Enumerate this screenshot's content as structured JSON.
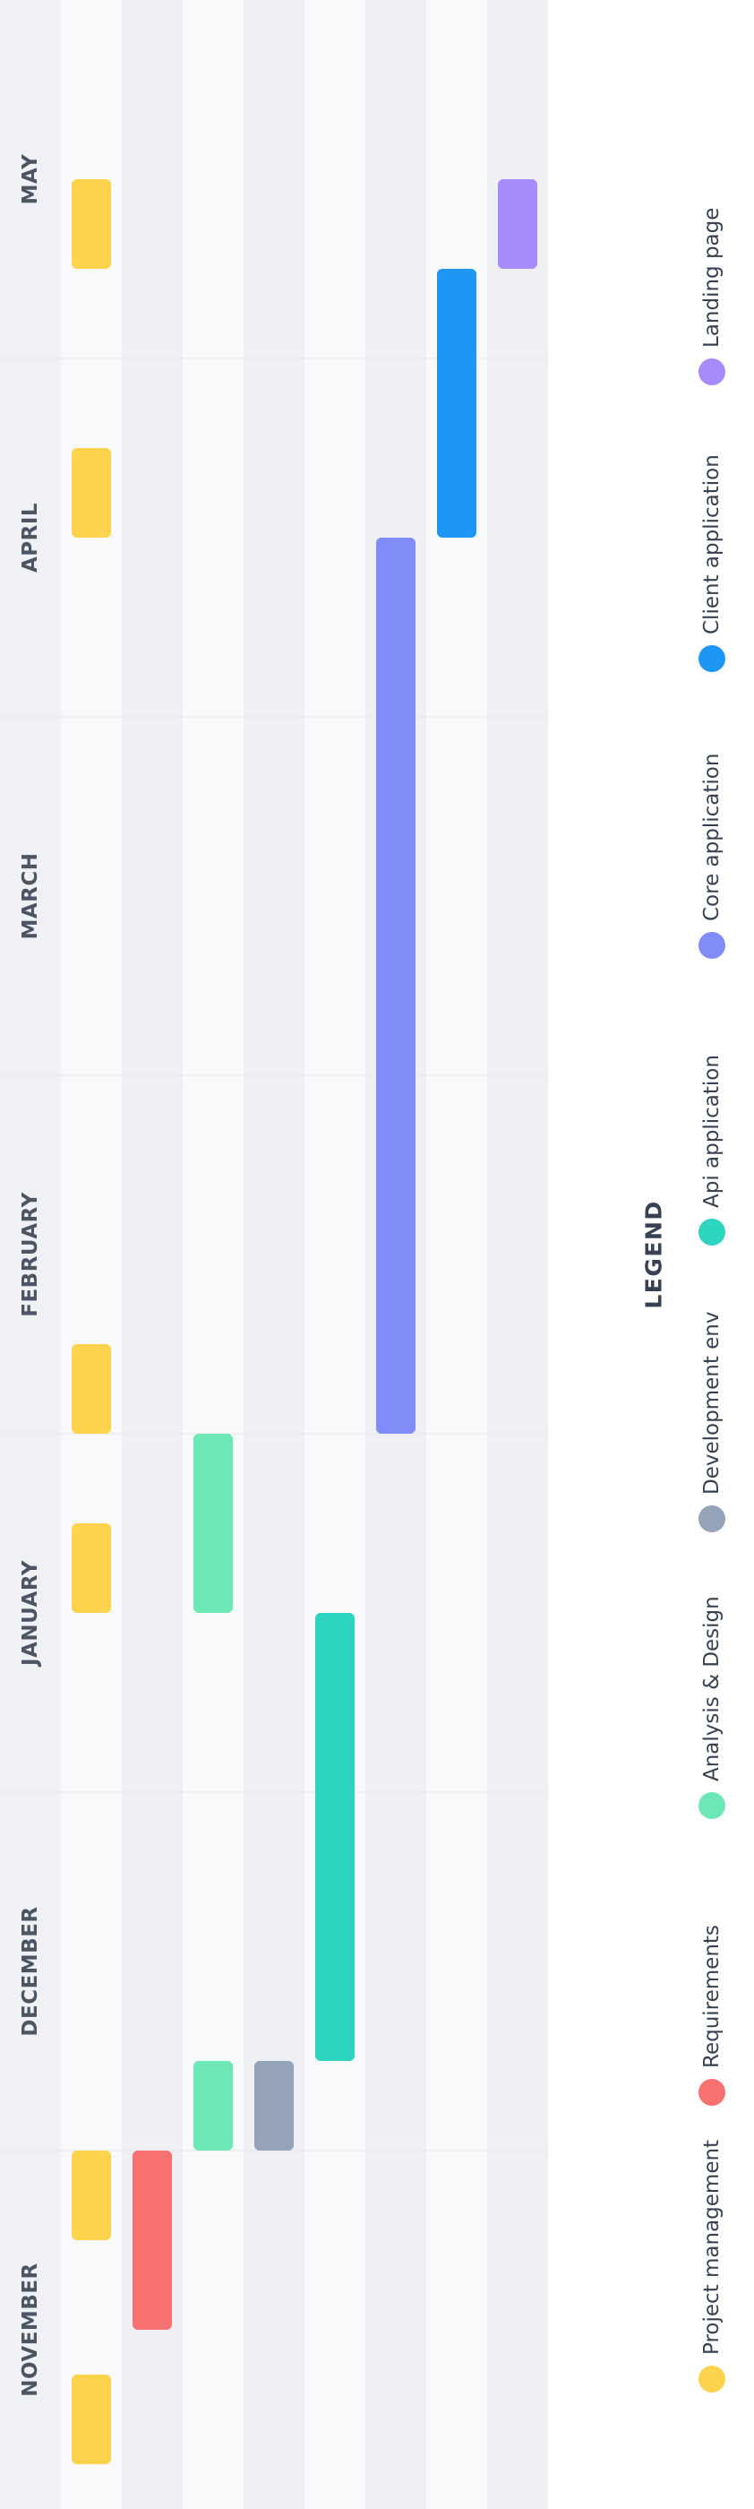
{
  "chart_data": {
    "type": "gantt",
    "title": "",
    "months": [
      "NOVEMBER",
      "DECEMBER",
      "JANUARY",
      "FEBRUARY",
      "MARCH",
      "APRIL",
      "MAY"
    ],
    "time_unit": "weeks",
    "weeks_per_month": 4,
    "legend_title": "LEGEND",
    "categories": [
      {
        "name": "Project management",
        "color": "#fcd34d"
      },
      {
        "name": "Requirements",
        "color": "#f87171"
      },
      {
        "name": "Analysis & Design",
        "color": "#6ee7b7"
      },
      {
        "name": "Development env",
        "color": "#94a3b8"
      },
      {
        "name": "Api application",
        "color": "#2dd4bf"
      },
      {
        "name": "Core application",
        "color": "#818cf8"
      },
      {
        "name": "Client application",
        "color": "#1e96f5"
      },
      {
        "name": "Landing page",
        "color": "#a78bfa"
      }
    ],
    "tasks": [
      {
        "category": "Project management",
        "start": 0.5,
        "end": 1.5
      },
      {
        "category": "Project management",
        "start": 3.0,
        "end": 4.0
      },
      {
        "category": "Project management",
        "start": 10.0,
        "end": 11.0
      },
      {
        "category": "Project management",
        "start": 12.0,
        "end": 13.0
      },
      {
        "category": "Project management",
        "start": 22.0,
        "end": 23.0
      },
      {
        "category": "Project management",
        "start": 25.0,
        "end": 26.0
      },
      {
        "category": "Requirements",
        "start": 2.0,
        "end": 4.0
      },
      {
        "category": "Analysis & Design",
        "start": 4.0,
        "end": 5.0
      },
      {
        "category": "Analysis & Design",
        "start": 10.0,
        "end": 12.0
      },
      {
        "category": "Development env",
        "start": 4.0,
        "end": 5.0
      },
      {
        "category": "Api application",
        "start": 5.0,
        "end": 10.0
      },
      {
        "category": "Core application",
        "start": 12.0,
        "end": 22.0
      },
      {
        "category": "Client application",
        "start": 22.0,
        "end": 25.0
      },
      {
        "category": "Landing page",
        "start": 25.0,
        "end": 26.0
      }
    ]
  }
}
